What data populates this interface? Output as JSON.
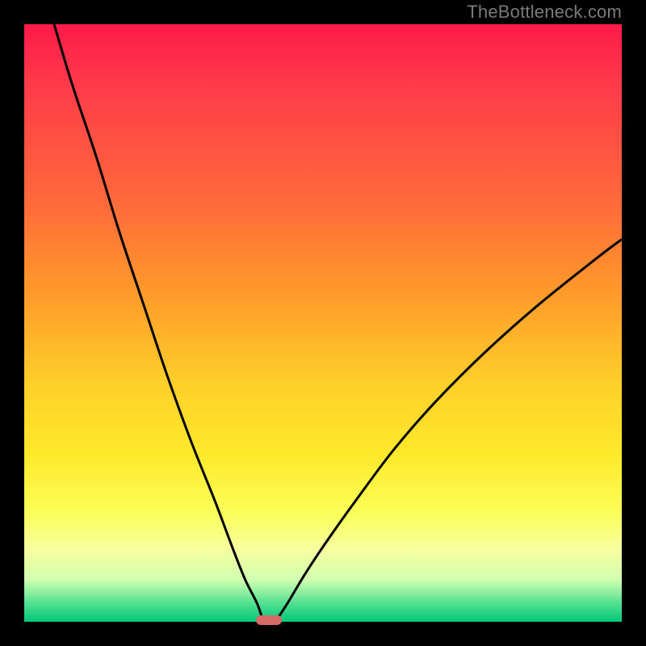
{
  "watermark": "TheBottleneck.com",
  "colors": {
    "gradient_top": "#ff1a4a",
    "gradient_mid_upper": "#ff9a2a",
    "gradient_mid_lower": "#ffe92a",
    "gradient_bottom": "#00c878",
    "curve": "#000000",
    "marker": "#d66a66",
    "frame": "#000000"
  },
  "chart_data": {
    "type": "line",
    "title": "",
    "xlabel": "",
    "ylabel": "",
    "xlim": [
      0,
      100
    ],
    "ylim": [
      0,
      100
    ],
    "grid": false,
    "legend": false,
    "annotations": [
      {
        "text": "TheBottleneck.com",
        "position": "top-right"
      }
    ],
    "series": [
      {
        "name": "left-branch",
        "x": [
          5,
          8,
          12,
          16,
          20,
          24,
          28,
          32,
          35,
          37,
          39,
          40
        ],
        "y": [
          100,
          90,
          78,
          65,
          53,
          41,
          30,
          20,
          12,
          7,
          3,
          0
        ]
      },
      {
        "name": "right-branch",
        "x": [
          42,
          44,
          47,
          51,
          56,
          62,
          69,
          77,
          86,
          96,
          100
        ],
        "y": [
          0,
          3,
          8,
          14,
          21,
          29,
          37,
          45,
          53,
          61,
          64
        ]
      }
    ],
    "marker": {
      "name": "optimal-point",
      "x": 41,
      "y": 0,
      "width_pct": 4.3,
      "height_pct": 1.6
    },
    "notes": "V-shaped bottleneck curve; minimum at roughly x=41. Background color encodes bottleneck severity (red=high, green=low)."
  }
}
